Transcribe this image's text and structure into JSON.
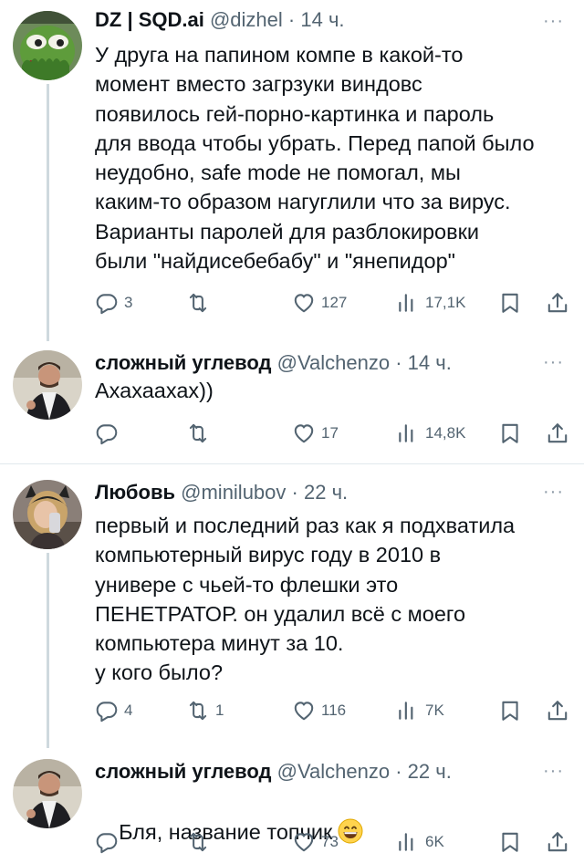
{
  "tweets": [
    {
      "name": "DZ | SQD.ai",
      "handle": "@dizhel",
      "dot": "·",
      "time": "14 ч.",
      "more": "···",
      "avatar_icon": "pepe-avatar",
      "text": "У друга на папином компе в какой-то\nмомент вместо загрзуки виндовс\nпоявилось гей-порно-картинка и пароль\nдля ввода чтобы убрать. Перед папой было\nнеудобно, safe mode не помогал, мы\nкаким-то образом нагуглили что за вирус.\nВарианты паролей для разблокировки\nбыли \"найдисебебабу\" и \"янепидор\"",
      "replies": "3",
      "retweets": "",
      "likes": "127",
      "views": "17,1K"
    },
    {
      "name": "сложный углевод",
      "handle": "@Valchenzo",
      "dot": "·",
      "time": "14 ч.",
      "more": "···",
      "avatar_icon": "man-avatar",
      "text": "Ахахаахах))",
      "replies": "",
      "retweets": "",
      "likes": "17",
      "views": "14,8K"
    },
    {
      "name": "Любовь",
      "handle": "@minilubov",
      "dot": "·",
      "time": "22 ч.",
      "more": "···",
      "avatar_icon": "woman-avatar",
      "text": "первый и последний раз как я подхватила\nкомпьютерный вирус году в 2010 в\nунивере с чьей-то флешки это\nПЕНЕТРАТОР. он удалил всё с моего\nкомпьютера минут за 10.\nу кого было?",
      "replies": "4",
      "retweets": "1",
      "likes": "116",
      "views": "7K"
    },
    {
      "name": "сложный углевод",
      "handle": "@Valchenzo",
      "dot": "·",
      "time": "22 ч.",
      "more": "···",
      "avatar_icon": "man-avatar",
      "text": "Бля, название топчик",
      "emoji": "grinning-face-emoji",
      "replies": "",
      "retweets": "",
      "likes": "73",
      "views": "6K"
    }
  ],
  "colors": {
    "text": "#0f1419",
    "secondary": "#536471",
    "thread_line": "#cfd9de",
    "divider": "#e1e8ed"
  }
}
